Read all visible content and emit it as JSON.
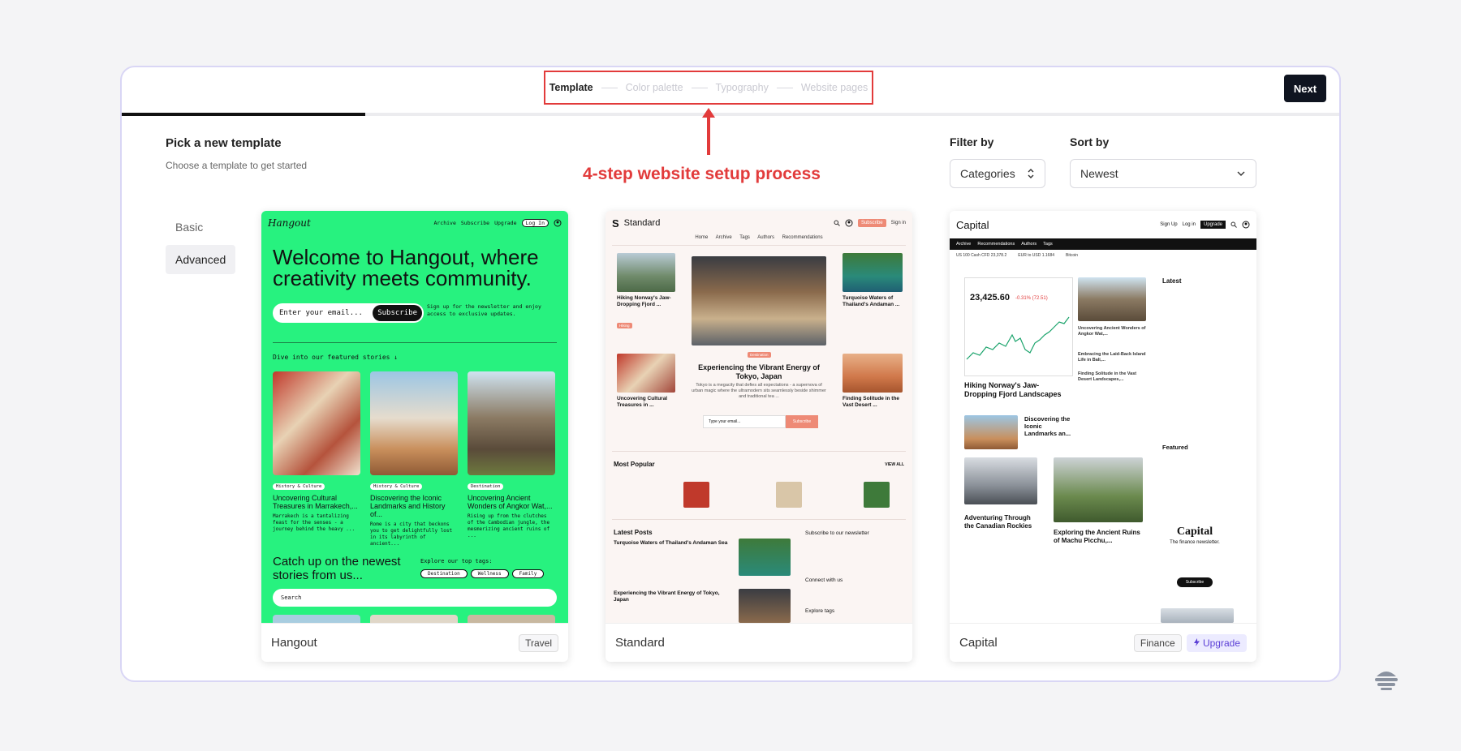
{
  "steps": [
    "Template",
    "Color palette",
    "Typography",
    "Website pages"
  ],
  "progress_fraction": 0.2,
  "next_label": "Next",
  "annotation": "4-step website setup process",
  "heading": "Pick a new template",
  "subheading": "Choose a template to get started",
  "filter": {
    "label": "Filter by",
    "value": "Categories"
  },
  "sort": {
    "label": "Sort by",
    "value": "Newest"
  },
  "sidebar": {
    "items": [
      {
        "label": "Basic"
      },
      {
        "label": "Advanced"
      }
    ]
  },
  "cards": [
    {
      "name": "Hangout",
      "tags": [
        "Travel"
      ]
    },
    {
      "name": "Standard",
      "tags": []
    },
    {
      "name": "Capital",
      "tags": [
        "Finance",
        "Upgrade"
      ]
    }
  ],
  "hangout": {
    "logo": "Hangout",
    "nav": [
      "Archive",
      "Subscribe",
      "Upgrade",
      "Log In"
    ],
    "title": "Welcome to Hangout, where creativity meets community.",
    "email_placeholder": "Enter your email...",
    "subscribe": "Subscribe",
    "signup_text": "Sign up for the newsletter and enjoy access to exclusive updates.",
    "featured": "Dive into our featured stories ↓",
    "stories": [
      {
        "badge": "History & Culture",
        "title": "Uncovering Cultural Treasures in Marrakech,...",
        "desc": "Marrakech is a tantalizing feast for the senses - a journey behind the heavy ..."
      },
      {
        "badge": "History & Culture",
        "title": "Discovering the Iconic Landmarks and History of...",
        "desc": "Rome is a city that beckons you to get delightfully lost in its labyrinth of ancient..."
      },
      {
        "badge": "Destination",
        "title": "Uncovering Ancient Wonders of Angkor Wat,...",
        "desc": "Rising up from the clutches of the Cambodian jungle, the mesmerizing ancient ruins of ..."
      }
    ],
    "catch_up": "Catch up on the newest stories from us...",
    "explore": "Explore our top tags:",
    "tags": [
      "Destination",
      "Wellness",
      "Family"
    ],
    "search": "Search"
  },
  "standard": {
    "logo": "S",
    "name": "Standard",
    "subscribe": "Subscribe",
    "sign_in": "Sign in",
    "menu": "Home Archive Tags Authors Recommendations",
    "left_1": "Hiking Norway's Jaw-Dropping Fjord ...",
    "left_2": "Uncovering Cultural Treasures in ...",
    "center_title": "Experiencing the Vibrant Energy of Tokyo, Japan",
    "center_desc": "Tokyo is a megacity that defies all expectations - a supernova of urban magic where the ultramodern sits seamlessly beside shimmer and traditional tea ...",
    "email_placeholder": "Type your email...",
    "subscribe_btn": "Subscribe",
    "right_1": "Turquoise Waters of Thailand's Andaman ...",
    "right_2": "Finding Solitude in the Vast Desert ...",
    "most_popular": "Most Popular",
    "view_all": "VIEW ALL",
    "latest_posts": "Latest Posts",
    "latest_1": "Turquoise Waters of Thailand's Andaman Sea",
    "latest_2": "Experiencing the Vibrant Energy of Tokyo, Japan",
    "subscribe_news": "Subscribe to our newsletter",
    "connect": "Connect with us",
    "explore_tags": "Explore tags"
  },
  "capital": {
    "name": "Capital",
    "nav": [
      "Sign Up",
      "Log in",
      "Upgrade"
    ],
    "bar": [
      "Archive",
      "Recommendations",
      "Authors",
      "Tags"
    ],
    "ticker": [
      "US 100 Cash CFD 23,378.2",
      "EUR to USD 1.1684",
      "Bitcoin"
    ],
    "price": "23,425.60",
    "change": "-0.31% (72.51)",
    "main_title": "Hiking Norway's Jaw-Dropping Fjord Landscapes",
    "latest": "Latest",
    "mid_1": "Uncovering Ancient Wonders of Angkor Wat,...",
    "mid_2": "Embracing the Laid-Back Island Life in Bali,...",
    "mid_3": "Finding Solitude in the Vast Desert Landscapes,...",
    "discover": "Discovering the Iconic Landmarks an...",
    "adventuring": "Adventuring Through the Canadian Rockies",
    "exploring": "Exploring the Ancient Ruins of Machu Picchu,...",
    "featured": "Featured",
    "cap_title": "Capital",
    "cap_sub": "The finance newsletter.",
    "cap_btn": "Subscribe"
  }
}
